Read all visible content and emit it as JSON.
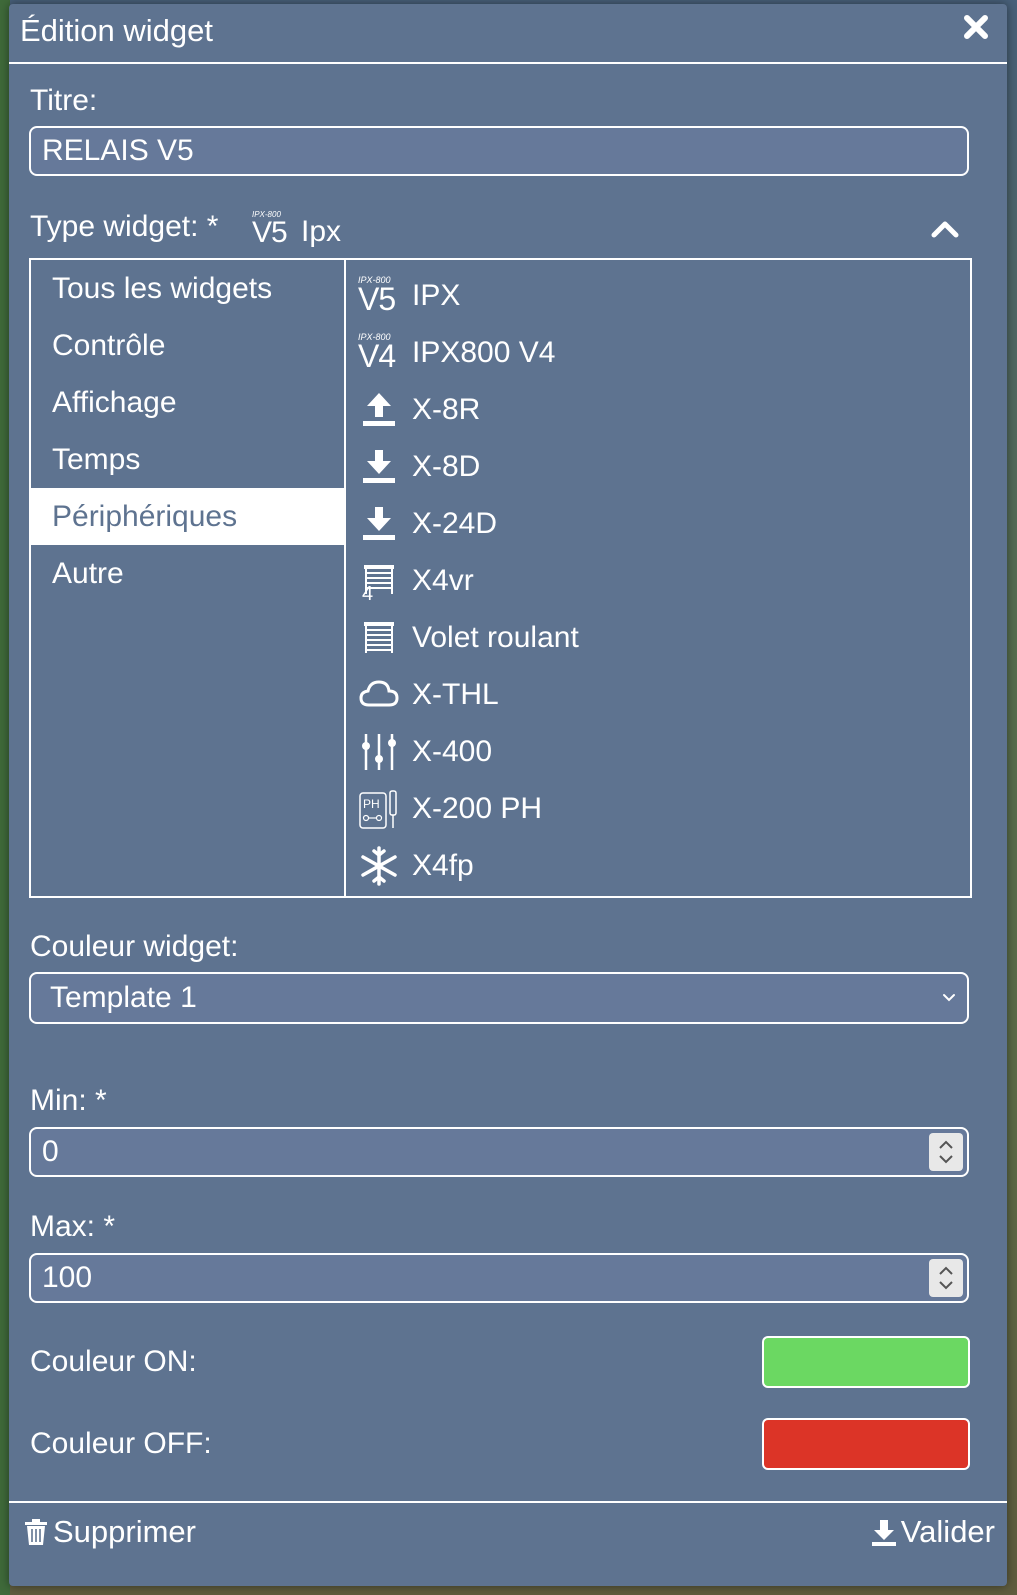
{
  "window": {
    "title": "Édition widget",
    "close_icon": "close-icon"
  },
  "titre": {
    "label": "Titre:",
    "value": "RELAIS V5"
  },
  "type_widget": {
    "label": "Type widget: *",
    "badge_small": "IPX-800",
    "badge_big": "V5",
    "selected_name": "Ipx",
    "toggle_icon": "chevron-up-icon"
  },
  "categories": [
    {
      "label": "Tous les widgets",
      "selected": false
    },
    {
      "label": "Contrôle",
      "selected": false
    },
    {
      "label": "Affichage",
      "selected": false
    },
    {
      "label": "Temps",
      "selected": false
    },
    {
      "label": "Périphériques",
      "selected": true
    },
    {
      "label": "Autre",
      "selected": false
    }
  ],
  "widgets": [
    {
      "name": "IPX",
      "icon": "ipx800-v5-icon",
      "badge_small": "IPX-800",
      "badge_big": "V5"
    },
    {
      "name": "IPX800 V4",
      "icon": "ipx800-v4-icon",
      "badge_small": "IPX-800",
      "badge_big": "V4"
    },
    {
      "name": "X-8R",
      "icon": "upload-icon"
    },
    {
      "name": "X-8D",
      "icon": "download-icon"
    },
    {
      "name": "X-24D",
      "icon": "download-icon"
    },
    {
      "name": "X4vr",
      "icon": "shutter-4-icon",
      "icon_text": "4"
    },
    {
      "name": "Volet roulant",
      "icon": "shutter-icon"
    },
    {
      "name": "X-THL",
      "icon": "cloud-icon"
    },
    {
      "name": "X-400",
      "icon": "sliders-icon"
    },
    {
      "name": "X-200 PH",
      "icon": "ph-probe-icon",
      "icon_text": "PH"
    },
    {
      "name": "X4fp",
      "icon": "snowflake-icon"
    }
  ],
  "couleur_widget": {
    "label": "Couleur widget:",
    "value": "Template 1"
  },
  "min": {
    "label": "Min: *",
    "value": "0"
  },
  "max": {
    "label": "Max: *",
    "value": "100"
  },
  "couleur_on": {
    "label": "Couleur ON:",
    "color": "#6bd862"
  },
  "couleur_off": {
    "label": "Couleur OFF:",
    "color": "#dc3427"
  },
  "footer": {
    "delete_label": "Supprimer",
    "submit_label": "Valider"
  },
  "colors": {
    "modal_bg": "#5e7390",
    "input_bg": "#66799a",
    "accent": "#ffffff"
  }
}
